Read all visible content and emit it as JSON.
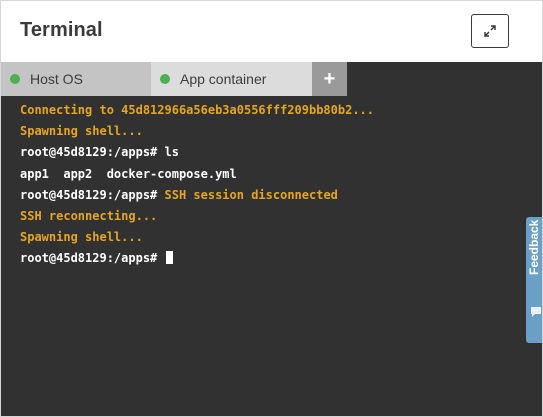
{
  "window": {
    "title": "Terminal",
    "expand_icon": "expand-arrows-icon"
  },
  "tabs": [
    {
      "label": "Host OS",
      "status_color": "#4cb050",
      "active": false
    },
    {
      "label": "App container",
      "status_color": "#4cb050",
      "active": true
    }
  ],
  "add_tab": {
    "label": "+"
  },
  "terminal": {
    "lines": [
      {
        "text": "Connecting to 45d812966a56eb3a0556fff209bb80b2...",
        "color": "#e6a61e"
      },
      {
        "text": "Spawning shell...",
        "color": "#e6a61e"
      },
      {
        "prompt": "root@45d8129:/apps# ",
        "command": "ls",
        "color": "#ffffff"
      },
      {
        "text": "app1  app2  docker-compose.yml",
        "color": "#ffffff"
      },
      {
        "prompt": "root@45d8129:/apps# ",
        "command": "SSH session disconnected",
        "command_color": "#e6a61e",
        "color": "#ffffff"
      },
      {
        "text": "SSH reconnecting...",
        "color": "#e6a61e"
      },
      {
        "text": "Spawning shell...",
        "color": "#e6a61e"
      },
      {
        "prompt": "root@45d8129:/apps# ",
        "command": "",
        "color": "#ffffff",
        "cursor": true
      }
    ]
  },
  "feedback": {
    "label": "Feedback",
    "icon": "chat-bubble-icon"
  },
  "colors": {
    "terminal_bg": "#313131",
    "accent_yellow": "#e6a61e",
    "status_green": "#4cb050",
    "feedback_blue": "#6a9fc6"
  }
}
